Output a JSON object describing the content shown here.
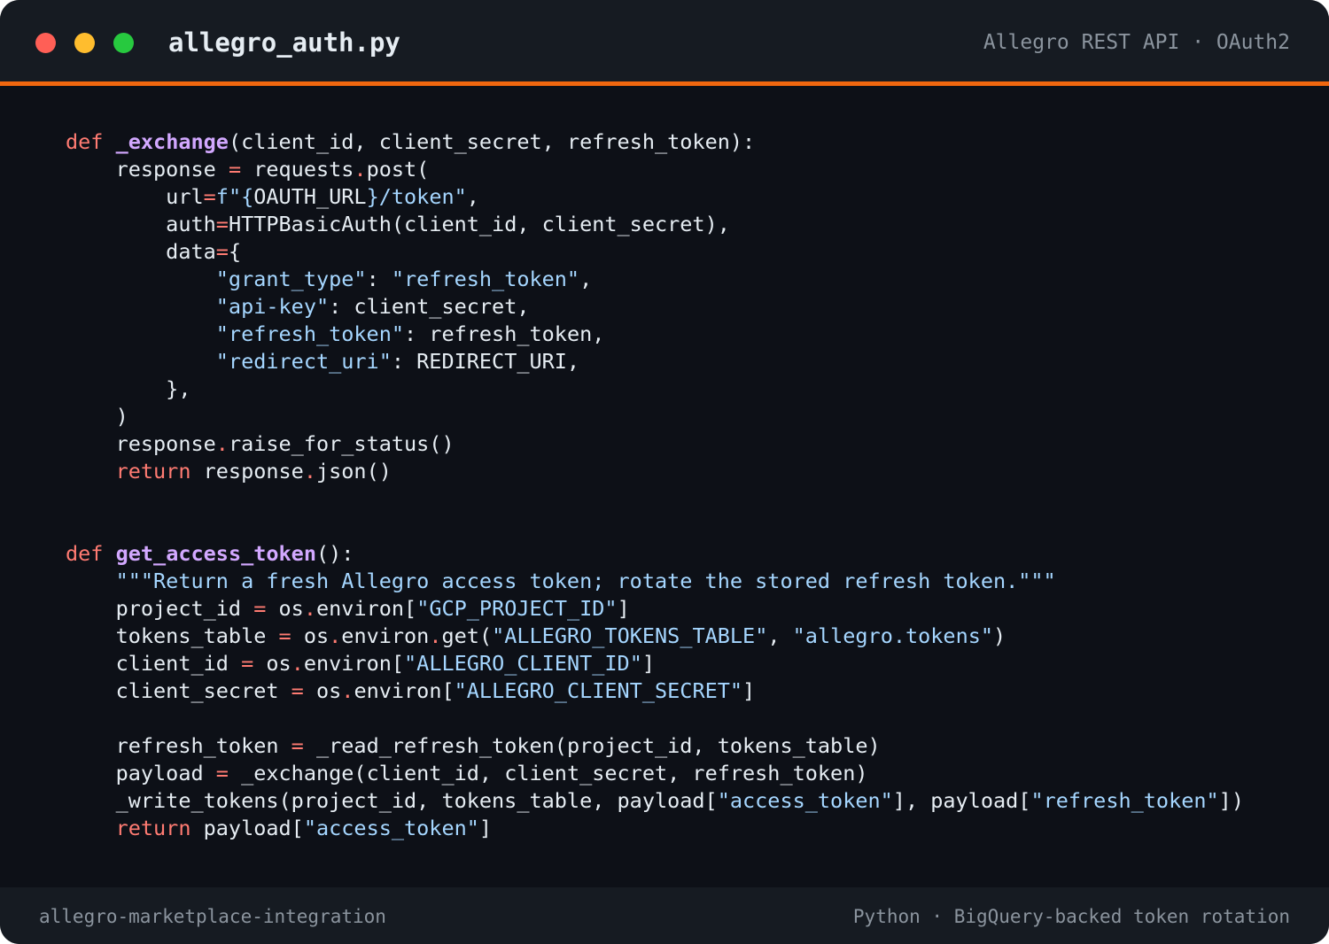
{
  "window": {
    "filename": "allegro_auth.py",
    "subtitle": "Allegro REST API · OAuth2",
    "accent_color": "#f0670f"
  },
  "footer": {
    "project": "allegro-marketplace-integration",
    "info": "Python · BigQuery-backed token rotation"
  },
  "code": {
    "lines": [
      [
        [
          "kw",
          "def"
        ],
        [
          "txt",
          " "
        ],
        [
          "fn",
          "_exchange"
        ],
        [
          "txt",
          "(client_id, client_secret, refresh_token):"
        ]
      ],
      [
        [
          "txt",
          "    response "
        ],
        [
          "op",
          "="
        ],
        [
          "txt",
          " requests"
        ],
        [
          "op",
          "."
        ],
        [
          "txt",
          "post("
        ]
      ],
      [
        [
          "txt",
          "        url"
        ],
        [
          "op",
          "="
        ],
        [
          "str",
          "f\"{"
        ],
        [
          "txt",
          "OAUTH_URL"
        ],
        [
          "str",
          "}/token\""
        ],
        [
          "txt",
          ","
        ]
      ],
      [
        [
          "txt",
          "        auth"
        ],
        [
          "op",
          "="
        ],
        [
          "txt",
          "HTTPBasicAuth(client_id, client_secret),"
        ]
      ],
      [
        [
          "txt",
          "        data"
        ],
        [
          "op",
          "="
        ],
        [
          "txt",
          "{"
        ]
      ],
      [
        [
          "txt",
          "            "
        ],
        [
          "str",
          "\"grant_type\""
        ],
        [
          "txt",
          ": "
        ],
        [
          "str",
          "\"refresh_token\""
        ],
        [
          "txt",
          ","
        ]
      ],
      [
        [
          "txt",
          "            "
        ],
        [
          "str",
          "\"api-key\""
        ],
        [
          "txt",
          ": client_secret,"
        ]
      ],
      [
        [
          "txt",
          "            "
        ],
        [
          "str",
          "\"refresh_token\""
        ],
        [
          "txt",
          ": refresh_token,"
        ]
      ],
      [
        [
          "txt",
          "            "
        ],
        [
          "str",
          "\"redirect_uri\""
        ],
        [
          "txt",
          ": REDIRECT_URI,"
        ]
      ],
      [
        [
          "txt",
          "        },"
        ]
      ],
      [
        [
          "txt",
          "    )"
        ]
      ],
      [
        [
          "txt",
          "    response"
        ],
        [
          "op",
          "."
        ],
        [
          "txt",
          "raise_for_status()"
        ]
      ],
      [
        [
          "txt",
          "    "
        ],
        [
          "kw",
          "return"
        ],
        [
          "txt",
          " response"
        ],
        [
          "op",
          "."
        ],
        [
          "txt",
          "json()"
        ]
      ],
      [],
      [],
      [
        [
          "kw",
          "def"
        ],
        [
          "txt",
          " "
        ],
        [
          "fn",
          "get_access_token"
        ],
        [
          "txt",
          "():"
        ]
      ],
      [
        [
          "txt",
          "    "
        ],
        [
          "str",
          "\"\"\"Return a fresh Allegro access token; rotate the stored refresh token.\"\"\""
        ]
      ],
      [
        [
          "txt",
          "    project_id "
        ],
        [
          "op",
          "="
        ],
        [
          "txt",
          " os"
        ],
        [
          "op",
          "."
        ],
        [
          "txt",
          "environ["
        ],
        [
          "str",
          "\"GCP_PROJECT_ID\""
        ],
        [
          "txt",
          "]"
        ]
      ],
      [
        [
          "txt",
          "    tokens_table "
        ],
        [
          "op",
          "="
        ],
        [
          "txt",
          " os"
        ],
        [
          "op",
          "."
        ],
        [
          "txt",
          "environ"
        ],
        [
          "op",
          "."
        ],
        [
          "txt",
          "get("
        ],
        [
          "str",
          "\"ALLEGRO_TOKENS_TABLE\""
        ],
        [
          "txt",
          ", "
        ],
        [
          "str",
          "\"allegro.tokens\""
        ],
        [
          "txt",
          ")"
        ]
      ],
      [
        [
          "txt",
          "    client_id "
        ],
        [
          "op",
          "="
        ],
        [
          "txt",
          " os"
        ],
        [
          "op",
          "."
        ],
        [
          "txt",
          "environ["
        ],
        [
          "str",
          "\"ALLEGRO_CLIENT_ID\""
        ],
        [
          "txt",
          "]"
        ]
      ],
      [
        [
          "txt",
          "    client_secret "
        ],
        [
          "op",
          "="
        ],
        [
          "txt",
          " os"
        ],
        [
          "op",
          "."
        ],
        [
          "txt",
          "environ["
        ],
        [
          "str",
          "\"ALLEGRO_CLIENT_SECRET\""
        ],
        [
          "txt",
          "]"
        ]
      ],
      [],
      [
        [
          "txt",
          "    refresh_token "
        ],
        [
          "op",
          "="
        ],
        [
          "txt",
          " _read_refresh_token(project_id, tokens_table)"
        ]
      ],
      [
        [
          "txt",
          "    payload "
        ],
        [
          "op",
          "="
        ],
        [
          "txt",
          " _exchange(client_id, client_secret, refresh_token)"
        ]
      ],
      [
        [
          "txt",
          "    _write_tokens(project_id, tokens_table, payload["
        ],
        [
          "str",
          "\"access_token\""
        ],
        [
          "txt",
          "], payload["
        ],
        [
          "str",
          "\"refresh_token\""
        ],
        [
          "txt",
          "])"
        ]
      ],
      [
        [
          "txt",
          "    "
        ],
        [
          "kw",
          "return"
        ],
        [
          "txt",
          " payload["
        ],
        [
          "str",
          "\"access_token\""
        ],
        [
          "txt",
          "]"
        ]
      ]
    ]
  }
}
